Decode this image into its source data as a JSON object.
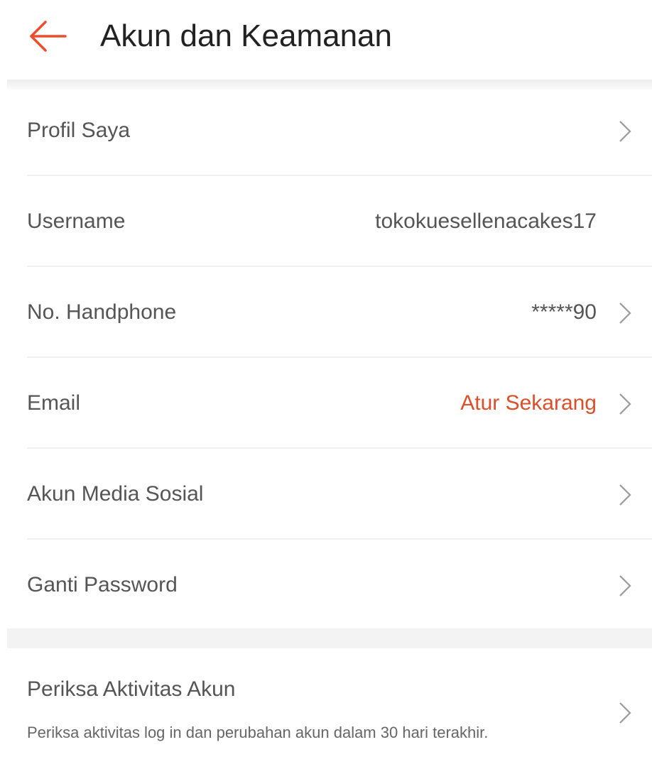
{
  "header": {
    "back_icon": "arrow-left-icon",
    "title": "Akun dan Keamanan",
    "accent_color": "#ee4d2d"
  },
  "menu": [
    {
      "id": "profil-saya",
      "label": "Profil Saya",
      "value": "",
      "chevron": true
    },
    {
      "id": "username",
      "label": "Username",
      "value": "tokokuesellenacakes17",
      "chevron": false
    },
    {
      "id": "no-handphone",
      "label": "No. Handphone",
      "value": "*****90",
      "chevron": true
    },
    {
      "id": "email",
      "label": "Email",
      "value": "Atur Sekarang",
      "value_color": "#d9502b",
      "chevron": true
    },
    {
      "id": "akun-media-sosial",
      "label": "Akun Media Sosial",
      "value": "",
      "chevron": true
    },
    {
      "id": "ganti-password",
      "label": "Ganti Password",
      "value": "",
      "chevron": true
    }
  ],
  "activity": {
    "label": "Periksa Aktivitas Akun",
    "description": "Periksa aktivitas log in dan perubahan akun dalam 30 hari terakhir."
  },
  "icons": {
    "chevron": "chevron-right-icon"
  }
}
